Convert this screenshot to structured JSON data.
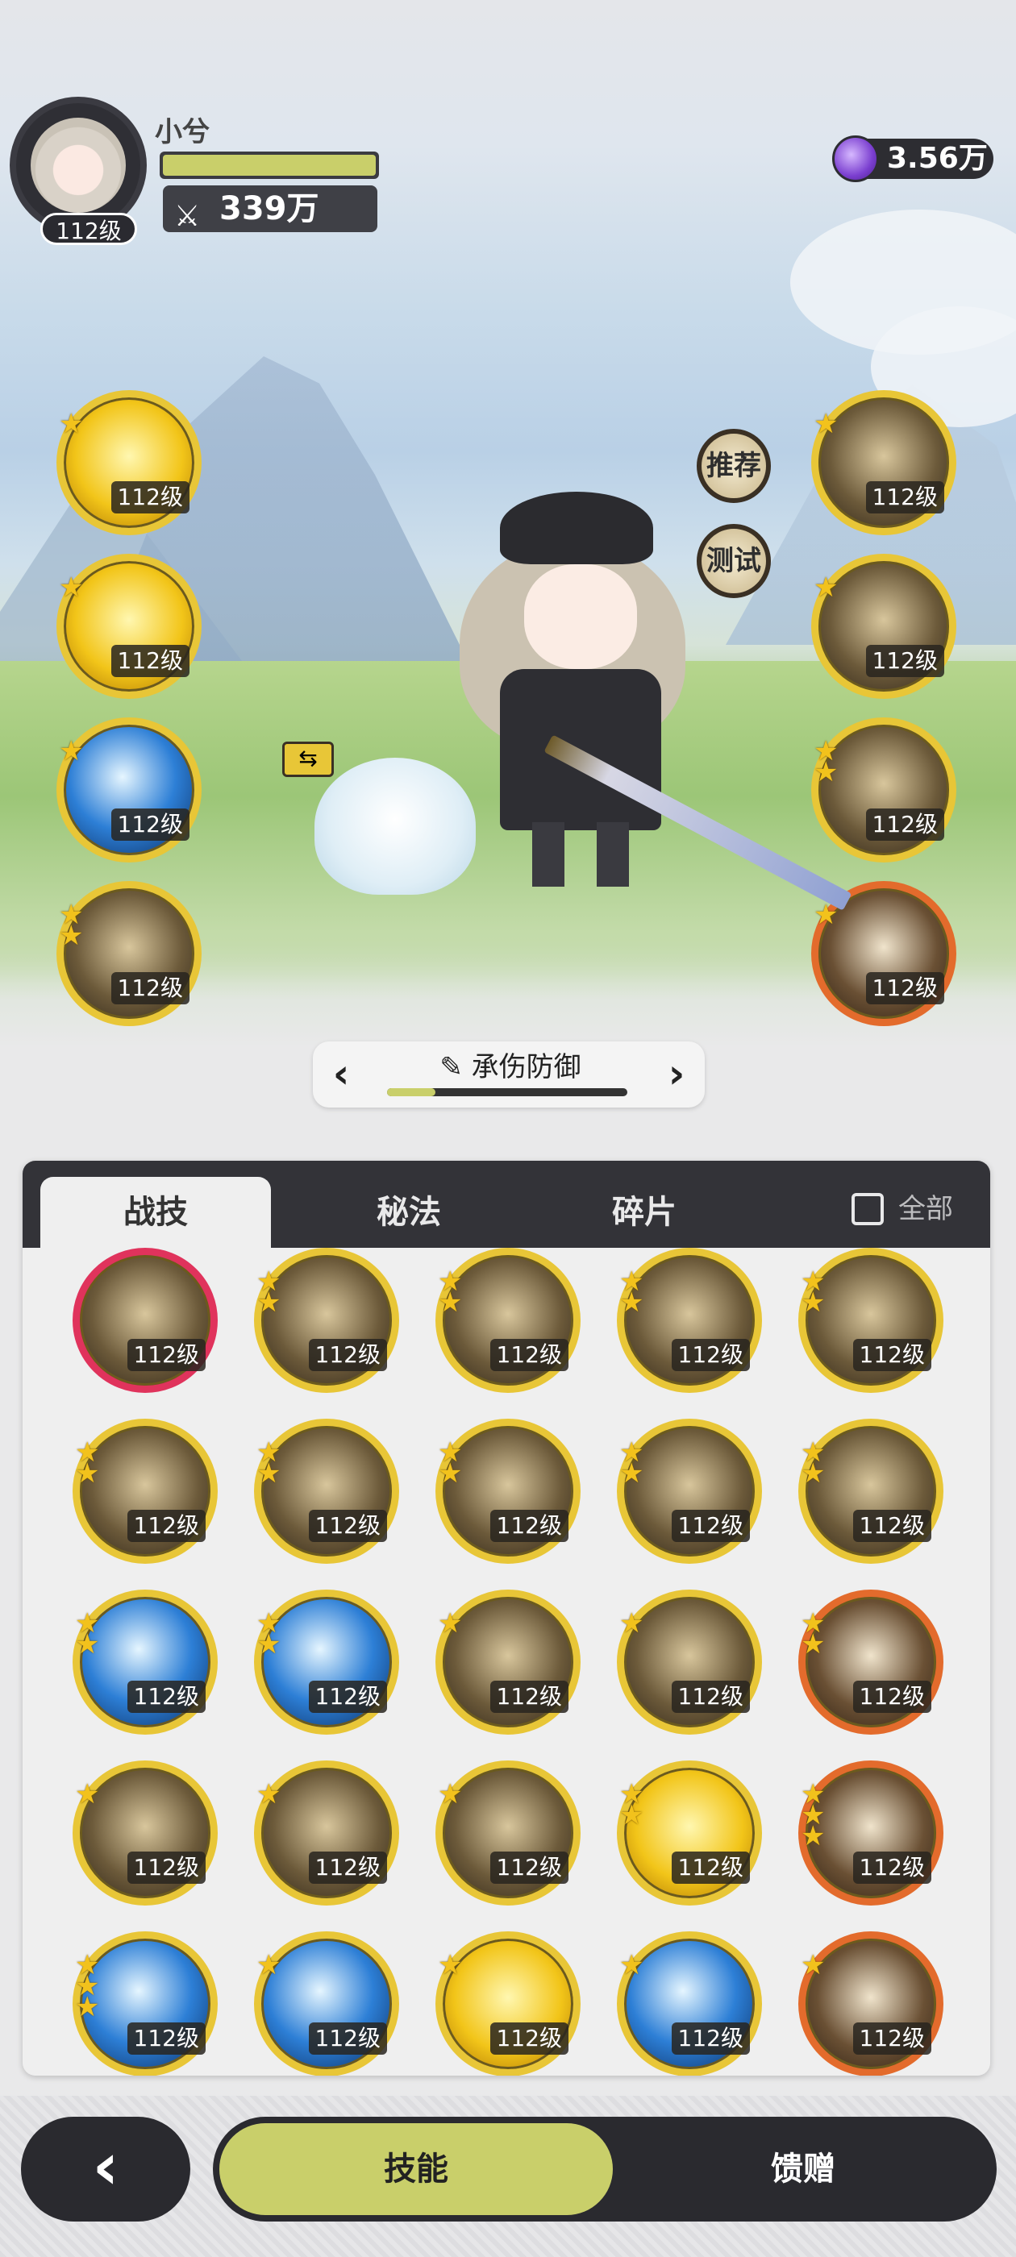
{
  "player": {
    "name": "小兮",
    "level": "112级",
    "power": "339万",
    "hp_fraction": 1.0
  },
  "currency": {
    "value": "3.56万",
    "icon": "gem-icon"
  },
  "left_skills": [
    {
      "level": "112级",
      "stars": 1,
      "style": "gold"
    },
    {
      "level": "112级",
      "stars": 1,
      "style": "gold"
    },
    {
      "level": "112级",
      "stars": 1,
      "style": "blue"
    },
    {
      "level": "112级",
      "stars": 2,
      "style": "dark"
    }
  ],
  "right_skills": [
    {
      "level": "112级",
      "stars": 1,
      "style": "dark"
    },
    {
      "level": "112级",
      "stars": 1,
      "style": "dark"
    },
    {
      "level": "112级",
      "stars": 2,
      "style": "dark"
    },
    {
      "level": "112级",
      "stars": 1,
      "style": "red"
    }
  ],
  "side_buttons": {
    "recommend": "推荐",
    "test": "测试"
  },
  "preset": {
    "name": "承伤防御",
    "progress": 0.2
  },
  "tabs": {
    "t1": "战技",
    "t2": "秘法",
    "t3": "碎片",
    "all": "全部"
  },
  "grid_skills": [
    {
      "level": "112级",
      "stars": 0,
      "style": "dark"
    },
    {
      "level": "112级",
      "stars": 2,
      "style": "dark"
    },
    {
      "level": "112级",
      "stars": 2,
      "style": "dark"
    },
    {
      "level": "112级",
      "stars": 2,
      "style": "dark"
    },
    {
      "level": "112级",
      "stars": 2,
      "style": "dark"
    },
    {
      "level": "112级",
      "stars": 2,
      "style": "dark"
    },
    {
      "level": "112级",
      "stars": 2,
      "style": "dark"
    },
    {
      "level": "112级",
      "stars": 2,
      "style": "dark"
    },
    {
      "level": "112级",
      "stars": 2,
      "style": "dark"
    },
    {
      "level": "112级",
      "stars": 2,
      "style": "dark"
    },
    {
      "level": "112级",
      "stars": 2,
      "style": "blue"
    },
    {
      "level": "112级",
      "stars": 2,
      "style": "blue"
    },
    {
      "level": "112级",
      "stars": 1,
      "style": "dark"
    },
    {
      "level": "112级",
      "stars": 1,
      "style": "dark"
    },
    {
      "level": "112级",
      "stars": 2,
      "style": "red"
    },
    {
      "level": "112级",
      "stars": 1,
      "style": "dark"
    },
    {
      "level": "112级",
      "stars": 1,
      "style": "dark"
    },
    {
      "level": "112级",
      "stars": 1,
      "style": "dark"
    },
    {
      "level": "112级",
      "stars": 2,
      "style": "gold"
    },
    {
      "level": "112级",
      "stars": 3,
      "style": "red"
    },
    {
      "level": "112级",
      "stars": 3,
      "style": "blue"
    },
    {
      "level": "112级",
      "stars": 1,
      "style": "blue"
    },
    {
      "level": "112级",
      "stars": 1,
      "style": "gold"
    },
    {
      "level": "112级",
      "stars": 1,
      "style": "blue"
    },
    {
      "level": "112级",
      "stars": 1,
      "style": "red"
    }
  ],
  "nav": {
    "skills": "技能",
    "gift": "馈赠",
    "back_icon": "chevron-left-icon"
  }
}
